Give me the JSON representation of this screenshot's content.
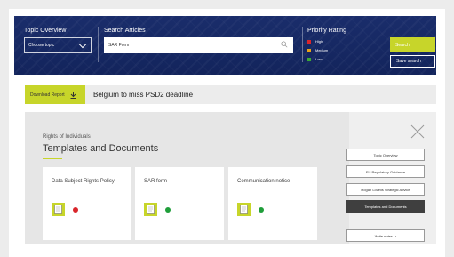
{
  "header": {
    "topic_label": "Topic Overview",
    "topic_placeholder": "Choose topic",
    "search_label": "Search Articles",
    "search_value": "SAR Form",
    "priority_label": "Priority Rating",
    "priority_levels": [
      {
        "label": "High",
        "color": "#d9252b"
      },
      {
        "label": "Medium",
        "color": "#e8a317"
      },
      {
        "label": "Low",
        "color": "#3aa935"
      }
    ],
    "search_button": "Search",
    "save_search_button": "Save search"
  },
  "news": {
    "download_button": "Download Report",
    "headline": "Belgium to miss PSD2 deadline"
  },
  "main": {
    "subtitle": "Rights of Individuals",
    "title": "Templates and Documents",
    "cards": [
      {
        "title": "Data Subject Rights Policy",
        "status_color": "#d9252b"
      },
      {
        "title": "SAR form",
        "status_color": "#1f9e3a"
      },
      {
        "title": "Communication notice",
        "status_color": "#1f9e3a"
      }
    ]
  },
  "sidebar": {
    "items": [
      {
        "label": "Topic Overview",
        "active": false
      },
      {
        "label": "EU Regulatory Guidance",
        "active": false
      },
      {
        "label": "Hogan Lovells Strategic Advice",
        "active": false
      },
      {
        "label": "Templates and Documents",
        "active": true
      }
    ],
    "write_notes": "Write notes",
    "write_notes_arrow": "›"
  },
  "colors": {
    "accent": "#c7d52a",
    "header_bg": "#13245c",
    "active_item": "#3f3f3f"
  }
}
